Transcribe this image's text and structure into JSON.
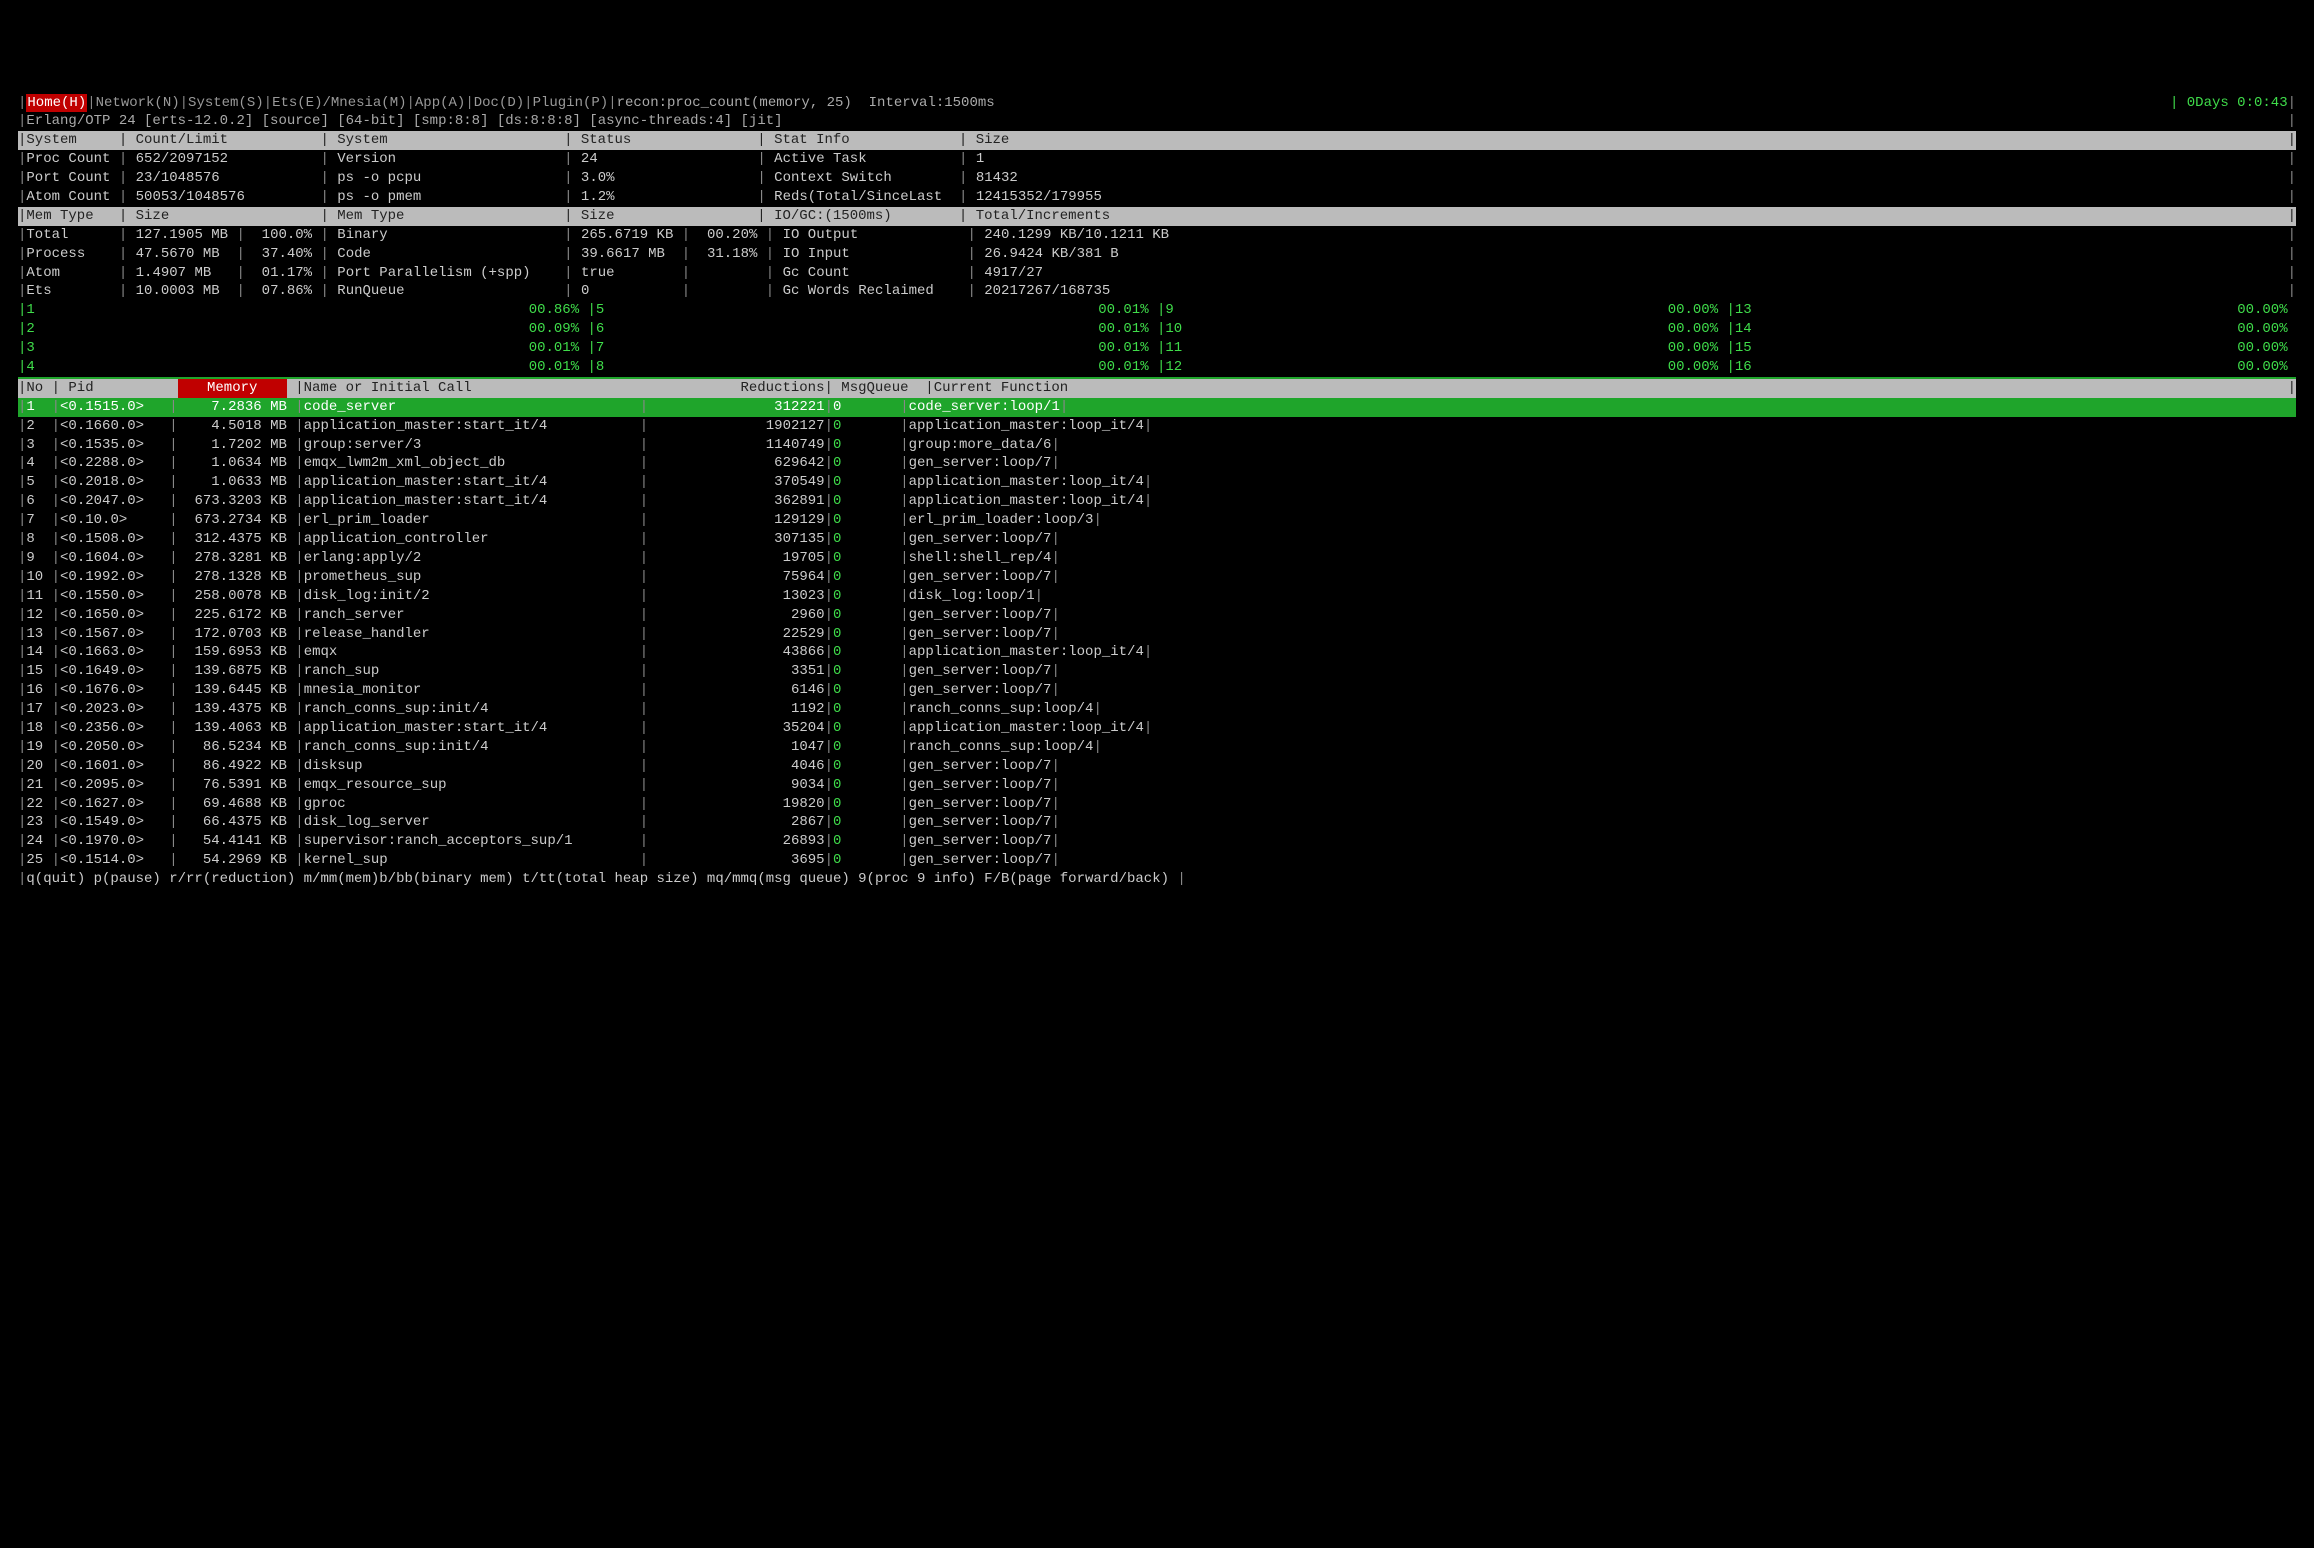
{
  "nav": {
    "home": "Home(H)",
    "items": [
      "Network(N)",
      "System(S)",
      "Ets(E)/Mnesia(M)",
      "App(A)",
      "Doc(D)",
      "Plugin(P)"
    ],
    "cmd": "recon:proc_count(memory, 25)",
    "interval": "Interval:1500ms",
    "uptime": "0Days 0:0:43"
  },
  "erlang_info": "Erlang/OTP 24 [erts-12.0.2] [source] [64-bit] [smp:8:8] [ds:8:8:8] [async-threads:4] [jit]",
  "sys_header1": [
    "System",
    "Count/Limit",
    "System",
    "Status",
    "Stat Info",
    "Size"
  ],
  "sys_rows1": [
    [
      "Proc Count",
      "652/2097152",
      "Version",
      "24",
      "Active Task",
      "1"
    ],
    [
      "Port Count",
      "23/1048576",
      "ps -o pcpu",
      "3.0%",
      "Context Switch",
      "81432"
    ],
    [
      "Atom Count",
      "50053/1048576",
      "ps -o pmem",
      "1.2%",
      "Reds(Total/SinceLast",
      "12415352/179955"
    ]
  ],
  "sys_header2": [
    "Mem Type",
    "Size",
    "Mem Type",
    "Size",
    "IO/GC:(1500ms)",
    "Total/Increments"
  ],
  "sys_rows2": [
    [
      "Total",
      "127.1905 MB",
      "100.0%",
      "Binary",
      "265.6719 KB",
      "00.20%",
      "IO Output",
      "240.1299 KB/10.1211 KB"
    ],
    [
      "Process",
      "47.5670 MB",
      "37.40%",
      "Code",
      "39.6617 MB",
      "31.18%",
      "IO Input",
      "26.9424 KB/381 B"
    ],
    [
      "Atom",
      "1.4907 MB",
      "01.17%",
      "Port Parallelism (+spp)",
      "true",
      "",
      "Gc Count",
      "4917/27"
    ],
    [
      "Ets",
      "10.0003 MB",
      "07.86%",
      "RunQueue",
      "0",
      "",
      "Gc Words Reclaimed",
      "20217267/168735"
    ]
  ],
  "schedulers": [
    {
      "id": "1",
      "pct": "00.86%"
    },
    {
      "id": "2",
      "pct": "00.09%"
    },
    {
      "id": "3",
      "pct": "00.01%"
    },
    {
      "id": "4",
      "pct": "00.01%"
    },
    {
      "id": "5",
      "pct": "00.01%"
    },
    {
      "id": "6",
      "pct": "00.01%"
    },
    {
      "id": "7",
      "pct": "00.01%"
    },
    {
      "id": "8",
      "pct": "00.01%"
    },
    {
      "id": "9",
      "pct": "00.00%"
    },
    {
      "id": "10",
      "pct": "00.00%"
    },
    {
      "id": "11",
      "pct": "00.00%"
    },
    {
      "id": "12",
      "pct": "00.00%"
    },
    {
      "id": "13",
      "pct": "00.00%"
    },
    {
      "id": "14",
      "pct": "00.00%"
    },
    {
      "id": "15",
      "pct": "00.00%"
    },
    {
      "id": "16",
      "pct": "00.00%"
    }
  ],
  "proc_header": [
    "No",
    "Pid",
    "Memory",
    "Name or Initial Call",
    "Reductions",
    "MsgQueue",
    "Current Function"
  ],
  "procs": [
    {
      "no": "1",
      "pid": "<0.1515.0>",
      "mem": "7.2836 MB",
      "name": "code_server",
      "red": "312221",
      "mq": "0",
      "fn": "code_server:loop/1",
      "sel": true
    },
    {
      "no": "2",
      "pid": "<0.1660.0>",
      "mem": "4.5018 MB",
      "name": "application_master:start_it/4",
      "red": "1902127",
      "mq": "0",
      "fn": "application_master:loop_it/4"
    },
    {
      "no": "3",
      "pid": "<0.1535.0>",
      "mem": "1.7202 MB",
      "name": "group:server/3",
      "red": "1140749",
      "mq": "0",
      "fn": "group:more_data/6"
    },
    {
      "no": "4",
      "pid": "<0.2288.0>",
      "mem": "1.0634 MB",
      "name": "emqx_lwm2m_xml_object_db",
      "red": "629642",
      "mq": "0",
      "fn": "gen_server:loop/7"
    },
    {
      "no": "5",
      "pid": "<0.2018.0>",
      "mem": "1.0633 MB",
      "name": "application_master:start_it/4",
      "red": "370549",
      "mq": "0",
      "fn": "application_master:loop_it/4"
    },
    {
      "no": "6",
      "pid": "<0.2047.0>",
      "mem": "673.3203 KB",
      "name": "application_master:start_it/4",
      "red": "362891",
      "mq": "0",
      "fn": "application_master:loop_it/4"
    },
    {
      "no": "7",
      "pid": "<0.10.0>",
      "mem": "673.2734 KB",
      "name": "erl_prim_loader",
      "red": "129129",
      "mq": "0",
      "fn": "erl_prim_loader:loop/3"
    },
    {
      "no": "8",
      "pid": "<0.1508.0>",
      "mem": "312.4375 KB",
      "name": "application_controller",
      "red": "307135",
      "mq": "0",
      "fn": "gen_server:loop/7"
    },
    {
      "no": "9",
      "pid": "<0.1604.0>",
      "mem": "278.3281 KB",
      "name": "erlang:apply/2",
      "red": "19705",
      "mq": "0",
      "fn": "shell:shell_rep/4"
    },
    {
      "no": "10",
      "pid": "<0.1992.0>",
      "mem": "278.1328 KB",
      "name": "prometheus_sup",
      "red": "75964",
      "mq": "0",
      "fn": "gen_server:loop/7"
    },
    {
      "no": "11",
      "pid": "<0.1550.0>",
      "mem": "258.0078 KB",
      "name": "disk_log:init/2",
      "red": "13023",
      "mq": "0",
      "fn": "disk_log:loop/1"
    },
    {
      "no": "12",
      "pid": "<0.1650.0>",
      "mem": "225.6172 KB",
      "name": "ranch_server",
      "red": "2960",
      "mq": "0",
      "fn": "gen_server:loop/7"
    },
    {
      "no": "13",
      "pid": "<0.1567.0>",
      "mem": "172.0703 KB",
      "name": "release_handler",
      "red": "22529",
      "mq": "0",
      "fn": "gen_server:loop/7"
    },
    {
      "no": "14",
      "pid": "<0.1663.0>",
      "mem": "159.6953 KB",
      "name": "emqx",
      "red": "43866",
      "mq": "0",
      "fn": "application_master:loop_it/4"
    },
    {
      "no": "15",
      "pid": "<0.1649.0>",
      "mem": "139.6875 KB",
      "name": "ranch_sup",
      "red": "3351",
      "mq": "0",
      "fn": "gen_server:loop/7"
    },
    {
      "no": "16",
      "pid": "<0.1676.0>",
      "mem": "139.6445 KB",
      "name": "mnesia_monitor",
      "red": "6146",
      "mq": "0",
      "fn": "gen_server:loop/7"
    },
    {
      "no": "17",
      "pid": "<0.2023.0>",
      "mem": "139.4375 KB",
      "name": "ranch_conns_sup:init/4",
      "red": "1192",
      "mq": "0",
      "fn": "ranch_conns_sup:loop/4"
    },
    {
      "no": "18",
      "pid": "<0.2356.0>",
      "mem": "139.4063 KB",
      "name": "application_master:start_it/4",
      "red": "35204",
      "mq": "0",
      "fn": "application_master:loop_it/4"
    },
    {
      "no": "19",
      "pid": "<0.2050.0>",
      "mem": "86.5234 KB",
      "name": "ranch_conns_sup:init/4",
      "red": "1047",
      "mq": "0",
      "fn": "ranch_conns_sup:loop/4"
    },
    {
      "no": "20",
      "pid": "<0.1601.0>",
      "mem": "86.4922 KB",
      "name": "disksup",
      "red": "4046",
      "mq": "0",
      "fn": "gen_server:loop/7"
    },
    {
      "no": "21",
      "pid": "<0.2095.0>",
      "mem": "76.5391 KB",
      "name": "emqx_resource_sup",
      "red": "9034",
      "mq": "0",
      "fn": "gen_server:loop/7"
    },
    {
      "no": "22",
      "pid": "<0.1627.0>",
      "mem": "69.4688 KB",
      "name": "gproc",
      "red": "19820",
      "mq": "0",
      "fn": "gen_server:loop/7"
    },
    {
      "no": "23",
      "pid": "<0.1549.0>",
      "mem": "66.4375 KB",
      "name": "disk_log_server",
      "red": "2867",
      "mq": "0",
      "fn": "gen_server:loop/7"
    },
    {
      "no": "24",
      "pid": "<0.1970.0>",
      "mem": "54.4141 KB",
      "name": "supervisor:ranch_acceptors_sup/1",
      "red": "26893",
      "mq": "0",
      "fn": "gen_server:loop/7"
    },
    {
      "no": "25",
      "pid": "<0.1514.0>",
      "mem": "54.2969 KB",
      "name": "kernel_sup",
      "red": "3695",
      "mq": "0",
      "fn": "gen_server:loop/7"
    }
  ],
  "footer": "q(quit) p(pause) r/rr(reduction) m/mm(mem)b/bb(binary mem) t/tt(total heap size) mq/mmq(msg queue) 9(proc 9 info) F/B(page forward/back)"
}
